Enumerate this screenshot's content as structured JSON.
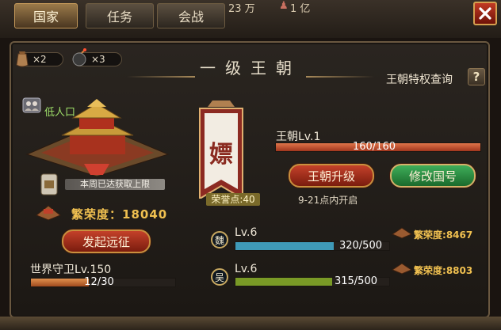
{
  "tabs": [
    {
      "label": "国家",
      "active": true
    },
    {
      "label": "任务",
      "active": false
    },
    {
      "label": "会战",
      "active": false
    }
  ],
  "top_stats": {
    "value1": "23 万",
    "value2": "1 亿"
  },
  "resources": [
    {
      "icon": "bag-icon",
      "count": "×2"
    },
    {
      "icon": "bomb-icon",
      "count": "×3"
    }
  ],
  "title": "一级王朝",
  "privilege_query": "王朝特权查询",
  "help_label": "?",
  "city": {
    "population_status": "低人口",
    "weekly_notice": "本周已达获取上限",
    "prosperity_label": "繁荣度：",
    "prosperity_value": "18040",
    "expedition_button": "发起远征"
  },
  "guardian": {
    "label": "世界守卫Lv.150",
    "progress_text": "12/30",
    "progress": 0.4
  },
  "dynasty": {
    "banner_char": "嫖",
    "honor_points": "荣誉点:40",
    "level_label": "王朝Lv.1",
    "exp_text": "160/160",
    "exp": 1.0,
    "upgrade_button": "王朝升级",
    "rename_button": "修改国号",
    "open_time": "9-21点内开启"
  },
  "kingdoms": [
    {
      "name": "魏",
      "level": "Lv.6",
      "progress_text": "320/500",
      "progress": 0.64,
      "prosperity_label": "繁荣度:",
      "prosperity_value": "8467",
      "color": "#3f9ab8"
    },
    {
      "name": "吴",
      "level": "Lv.6",
      "progress_text": "315/500",
      "progress": 0.63,
      "prosperity_label": "繁荣度:",
      "prosperity_value": "8803",
      "color": "#7a9a26"
    }
  ],
  "colors": {
    "accent_gold": "#f0c050",
    "exp_bar": "#c4562c",
    "guardian_bar": "#c8713a"
  }
}
